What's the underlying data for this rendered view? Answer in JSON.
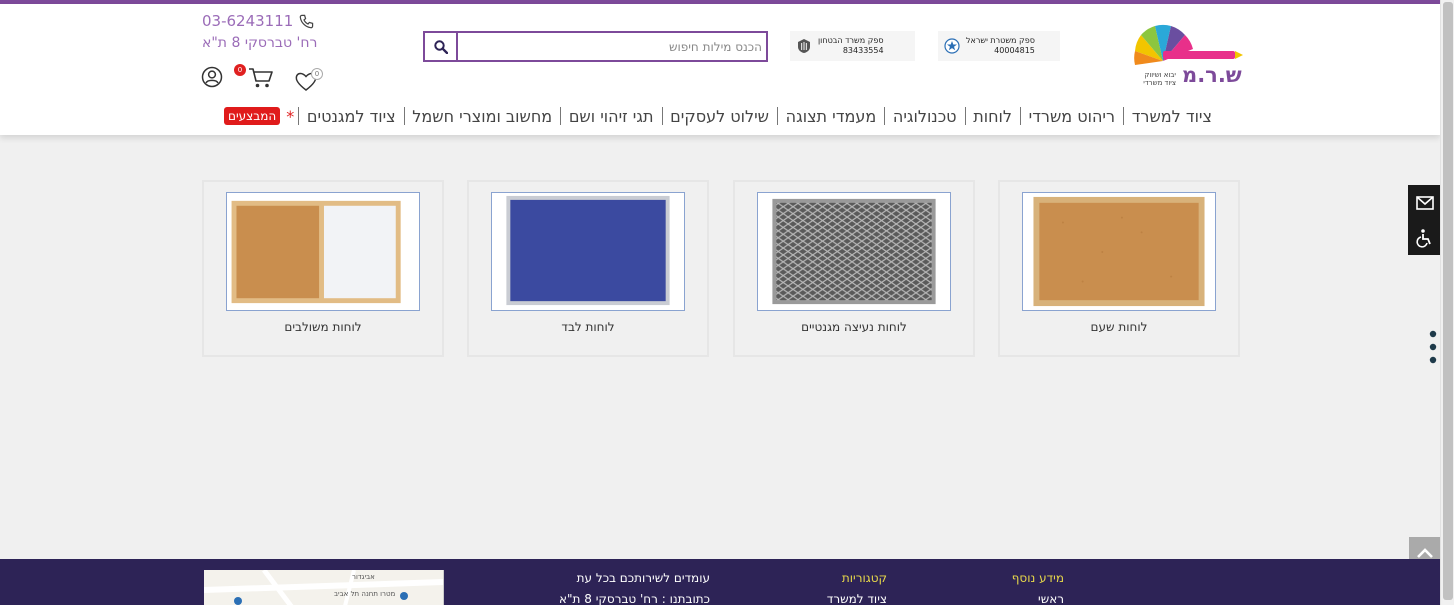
{
  "header": {
    "phone": "03-6243111",
    "address": "רח' טברסקי 8 ת\"א",
    "logo_text": "ש.ר.מ",
    "logo_sub": "יבוא ושיווק ציוד משרדי",
    "supplier_police": {
      "line1": "ספק משטרת ישראל",
      "line2": "40004815"
    },
    "supplier_defense": {
      "line1": "ספק משרד הבטחון",
      "line2": "83433554"
    },
    "search_placeholder": "הכנס מילות חיפוש",
    "cart_count": "0",
    "wishlist_count": "0"
  },
  "nav": {
    "items": [
      "ציוד למשרד",
      "ריהוט משרדי",
      "לוחות",
      "טכנולוגיה",
      "מעמדי תצוגה",
      "שילוט לעסקים",
      "תגי זיהוי ושם",
      "מחשוב ומוצרי חשמל",
      "ציוד למגנטים"
    ],
    "star": "*",
    "promo": "המבצעים"
  },
  "products": [
    {
      "label": "לוחות שעם",
      "image": "cork-board-image"
    },
    {
      "label": "לוחות נעיצה מגנטיים",
      "image": "magnetic-mesh-board-image"
    },
    {
      "label": "לוחות לבד",
      "image": "felt-board-image"
    },
    {
      "label": "לוחות משולבים",
      "image": "combo-board-image"
    }
  ],
  "footer": {
    "more_info_title": "מידע נוסף",
    "more_info_item": "ראשי",
    "categories_title": "קטגוריות",
    "categories_item": "ציוד למשרד",
    "service_line": "עומדים לשירותכם בכל עת",
    "address_line": "כתובתנו : רח' טברסקי 8 ת\"א",
    "map_label1": "אביגדור",
    "map_label2": "מטרו תחנה תל אביב"
  },
  "colors": {
    "brand": "#7d4a9a",
    "footer": "#2d2356",
    "promo": "#e01b1b",
    "footer_heading": "#e7d84a"
  }
}
